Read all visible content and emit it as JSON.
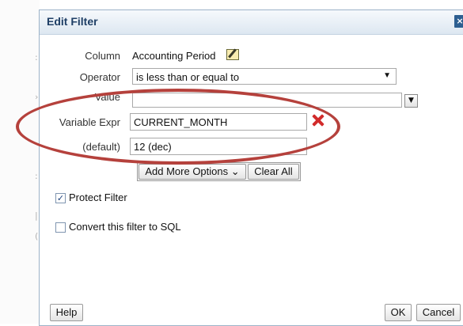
{
  "dialog": {
    "title": "Edit Filter",
    "close_label": "×"
  },
  "form": {
    "column": {
      "label": "Column",
      "value": "Accounting Period",
      "edit_icon": "edit-pencil-icon"
    },
    "operator": {
      "label": "Operator",
      "value": "is less than or equal to"
    },
    "value": {
      "label": "Value",
      "value": ""
    },
    "variable_expr": {
      "label": "Variable Expr",
      "value": "CURRENT_MONTH"
    },
    "default": {
      "label": "(default)",
      "value": "12 (dec)"
    }
  },
  "actions": {
    "add_more_options": "Add More Options",
    "add_more_chevron": "⌄",
    "clear_all": "Clear All"
  },
  "options": {
    "protect_filter": {
      "label": "Protect Filter",
      "checked": true,
      "mark": "✓"
    },
    "convert_sql": {
      "label": "Convert this filter to SQL",
      "checked": false,
      "mark": ""
    }
  },
  "footer": {
    "help": "Help",
    "ok": "OK",
    "cancel": "Cancel"
  },
  "colors": {
    "annotation_oval": "#b5413c",
    "remove_x": "#d22b2b",
    "title_text": "#1f3f66"
  }
}
